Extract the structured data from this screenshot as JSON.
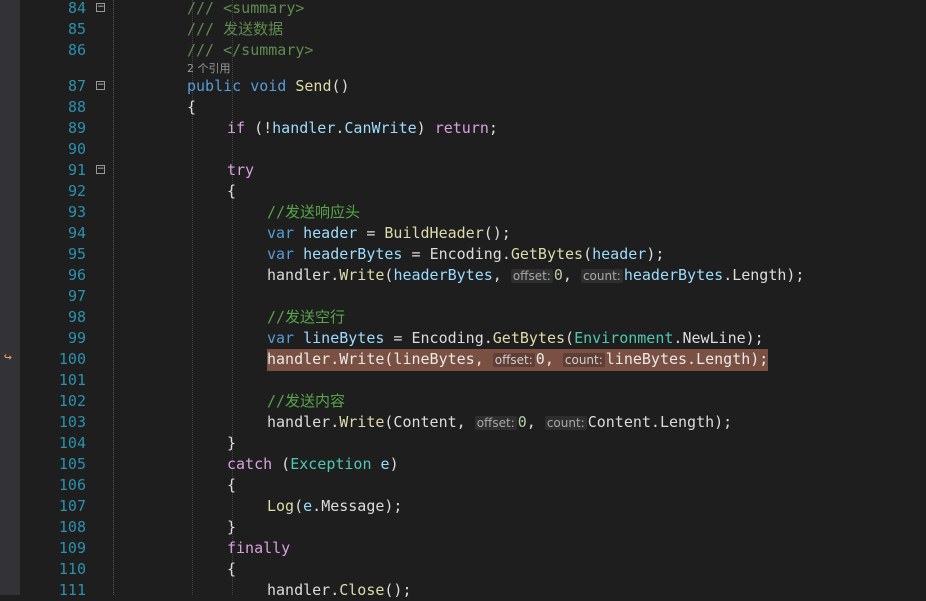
{
  "editor": {
    "codelens": "2 个引用",
    "hints": {
      "offset": "offset:",
      "count": "count:"
    },
    "lines": [
      {
        "n": "84",
        "parts": [
          {
            "c": "doc",
            "t": "/// <summary>"
          }
        ]
      },
      {
        "n": "85",
        "parts": [
          {
            "c": "doc",
            "t": "/// 发送数据"
          }
        ]
      },
      {
        "n": "86",
        "parts": [
          {
            "c": "doc",
            "t": "/// </summary>"
          }
        ]
      },
      {
        "n": "87",
        "parts": [
          {
            "c": "kw",
            "t": "public"
          },
          {
            "c": "pl",
            "t": " "
          },
          {
            "c": "kw",
            "t": "void"
          },
          {
            "c": "pl",
            "t": " "
          },
          {
            "c": "mth",
            "t": "Send"
          },
          {
            "c": "pl",
            "t": "()"
          }
        ]
      },
      {
        "n": "88",
        "parts": [
          {
            "c": "pl",
            "t": "{"
          }
        ]
      },
      {
        "n": "89",
        "parts": [
          {
            "c": "ctl",
            "t": "if"
          },
          {
            "c": "pl",
            "t": " (!"
          },
          {
            "c": "var",
            "t": "handler"
          },
          {
            "c": "pl",
            "t": "."
          },
          {
            "c": "var",
            "t": "CanWrite"
          },
          {
            "c": "pl",
            "t": ") "
          },
          {
            "c": "ctl",
            "t": "return"
          },
          {
            "c": "pl",
            "t": ";"
          }
        ]
      },
      {
        "n": "90",
        "parts": []
      },
      {
        "n": "91",
        "parts": [
          {
            "c": "ctl",
            "t": "try"
          }
        ]
      },
      {
        "n": "92",
        "parts": [
          {
            "c": "pl",
            "t": "{"
          }
        ]
      },
      {
        "n": "93",
        "parts": [
          {
            "c": "cmt",
            "t": "//发送响应头"
          }
        ]
      },
      {
        "n": "94",
        "parts": [
          {
            "c": "kw",
            "t": "var"
          },
          {
            "c": "pl",
            "t": " "
          },
          {
            "c": "var",
            "t": "header"
          },
          {
            "c": "pl",
            "t": " = "
          },
          {
            "c": "mth",
            "t": "BuildHeader"
          },
          {
            "c": "pl",
            "t": "();"
          }
        ]
      },
      {
        "n": "95",
        "parts": [
          {
            "c": "kw",
            "t": "var"
          },
          {
            "c": "pl",
            "t": " "
          },
          {
            "c": "var",
            "t": "headerBytes"
          },
          {
            "c": "pl",
            "t": " = "
          },
          {
            "c": "pl",
            "t": "Encoding"
          },
          {
            "c": "pl",
            "t": "."
          },
          {
            "c": "mth",
            "t": "GetBytes"
          },
          {
            "c": "pl",
            "t": "("
          },
          {
            "c": "var",
            "t": "header"
          },
          {
            "c": "pl",
            "t": ");"
          }
        ]
      },
      {
        "n": "96",
        "parts": [
          {
            "c": "pl",
            "t": "handler"
          },
          {
            "c": "pl",
            "t": "."
          },
          {
            "c": "mth",
            "t": "Write"
          },
          {
            "c": "pl",
            "t": "("
          },
          {
            "c": "var",
            "t": "headerBytes"
          },
          {
            "c": "pl",
            "t": ", "
          },
          {
            "c": "hint",
            "t": "offset:"
          },
          {
            "c": "num",
            "t": "0"
          },
          {
            "c": "pl",
            "t": ", "
          },
          {
            "c": "hint",
            "t": "count:"
          },
          {
            "c": "var",
            "t": "headerBytes"
          },
          {
            "c": "pl",
            "t": ".Length);"
          }
        ]
      },
      {
        "n": "97",
        "parts": []
      },
      {
        "n": "98",
        "parts": [
          {
            "c": "cmt",
            "t": "//发送空行"
          }
        ]
      },
      {
        "n": "99",
        "parts": [
          {
            "c": "kw",
            "t": "var"
          },
          {
            "c": "pl",
            "t": " "
          },
          {
            "c": "var",
            "t": "lineBytes"
          },
          {
            "c": "pl",
            "t": " = "
          },
          {
            "c": "pl",
            "t": "Encoding"
          },
          {
            "c": "pl",
            "t": "."
          },
          {
            "c": "mth",
            "t": "GetBytes"
          },
          {
            "c": "pl",
            "t": "("
          },
          {
            "c": "typ",
            "t": "Environment"
          },
          {
            "c": "pl",
            "t": "."
          },
          {
            "c": "pl",
            "t": "NewLine"
          },
          {
            "c": "pl",
            "t": ");"
          }
        ]
      },
      {
        "n": "100",
        "parts": [
          {
            "c": "pl",
            "t": "handler.Write(lineBytes, "
          },
          {
            "c": "hint",
            "t": "offset:"
          },
          {
            "c": "num",
            "t": "0"
          },
          {
            "c": "pl",
            "t": ", "
          },
          {
            "c": "hint",
            "t": "count:"
          },
          {
            "c": "pl",
            "t": "lineBytes.Length);"
          }
        ]
      },
      {
        "n": "101",
        "parts": []
      },
      {
        "n": "102",
        "parts": [
          {
            "c": "cmt",
            "t": "//发送内容"
          }
        ]
      },
      {
        "n": "103",
        "parts": [
          {
            "c": "pl",
            "t": "handler"
          },
          {
            "c": "pl",
            "t": "."
          },
          {
            "c": "mth",
            "t": "Write"
          },
          {
            "c": "pl",
            "t": "(Content, "
          },
          {
            "c": "hint",
            "t": "offset:"
          },
          {
            "c": "num",
            "t": "0"
          },
          {
            "c": "pl",
            "t": ", "
          },
          {
            "c": "hint",
            "t": "count:"
          },
          {
            "c": "pl",
            "t": "Content.Length);"
          }
        ]
      },
      {
        "n": "104",
        "parts": [
          {
            "c": "pl",
            "t": "}"
          }
        ]
      },
      {
        "n": "105",
        "parts": [
          {
            "c": "ctl",
            "t": "catch"
          },
          {
            "c": "pl",
            "t": " ("
          },
          {
            "c": "typ",
            "t": "Exception"
          },
          {
            "c": "pl",
            "t": " "
          },
          {
            "c": "var",
            "t": "e"
          },
          {
            "c": "pl",
            "t": ")"
          }
        ]
      },
      {
        "n": "106",
        "parts": [
          {
            "c": "pl",
            "t": "{"
          }
        ]
      },
      {
        "n": "107",
        "parts": [
          {
            "c": "mth",
            "t": "Log"
          },
          {
            "c": "pl",
            "t": "("
          },
          {
            "c": "var",
            "t": "e"
          },
          {
            "c": "pl",
            "t": "."
          },
          {
            "c": "pl",
            "t": "Message"
          },
          {
            "c": "pl",
            "t": ");"
          }
        ]
      },
      {
        "n": "108",
        "parts": [
          {
            "c": "pl",
            "t": "}"
          }
        ]
      },
      {
        "n": "109",
        "parts": [
          {
            "c": "ctl",
            "t": "finally"
          }
        ]
      },
      {
        "n": "110",
        "parts": [
          {
            "c": "pl",
            "t": "{"
          }
        ]
      },
      {
        "n": "111",
        "parts": [
          {
            "c": "pl",
            "t": "handler"
          },
          {
            "c": "pl",
            "t": "."
          },
          {
            "c": "mth",
            "t": "Close"
          },
          {
            "c": "pl",
            "t": "();"
          }
        ]
      }
    ]
  },
  "colors": {
    "background": "#1e1e1e",
    "line_number": "#2b91af",
    "current_line_highlight": "#7a5042"
  },
  "icons": {
    "execution_pointer": "current-statement-arrow-icon",
    "fold": "collapse-icon"
  }
}
